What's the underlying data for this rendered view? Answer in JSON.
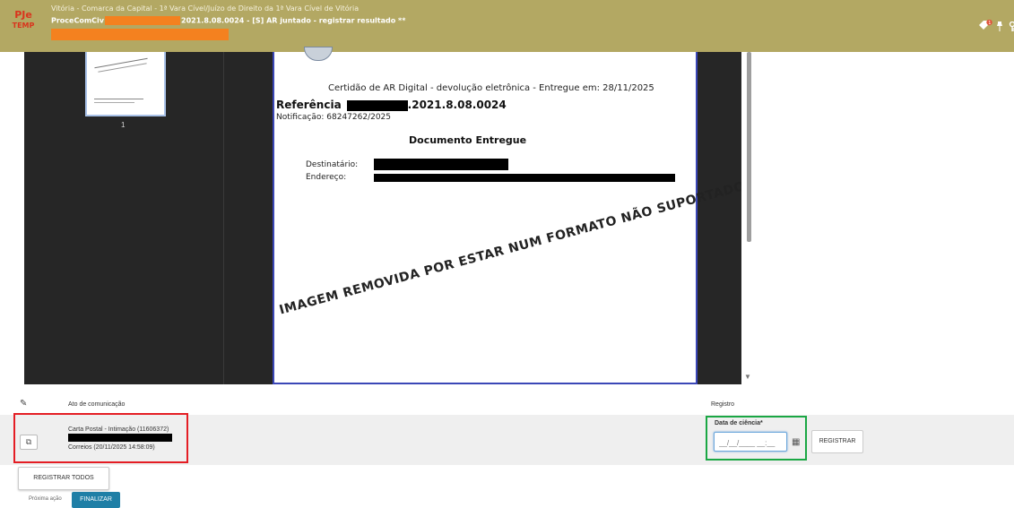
{
  "header": {
    "logo_line1": "PJe",
    "logo_line2": "TEMP",
    "court": "Vitória - Comarca da Capital - 1ª Vara Cível/Juízo de Direito da 1ª Vara Cível de Vitória",
    "class": "ProceComCiv",
    "process_suffix": "2021.8.08.0024 - [S] AR juntado - registrar resultado **",
    "notification_count": "1",
    "icons": [
      "tags-icon",
      "pin-icon",
      "key-icon"
    ]
  },
  "viewer": {
    "thumbnail_page": "1",
    "document": {
      "certidao": "Certidão de AR Digital - devolução eletrônica - Entregue em: 28/11/2025",
      "referencia_label": "Referência",
      "referencia_suffix": ".2021.8.08.0024",
      "notificacao": "Notificação:  68247262/2025",
      "entregue": "Documento Entregue",
      "destinatario_label": "Destinatário:",
      "endereco_label": "Endereço:",
      "removed_notice": "IMAGEM REMOVIDA POR ESTAR NUM FORMATO NÃO SUPORTADO"
    }
  },
  "table": {
    "col_ato": "Ato de comunicação",
    "col_registro": "Registro",
    "row": {
      "line1": "Carta Postal - Intimação (11606372)",
      "line3": "Correios (20/11/2025 14:58:09)"
    },
    "date_label": "Data de ciência*",
    "date_placeholder": "__/__/____ __:__",
    "registrar_label": "REGISTRAR"
  },
  "footer": {
    "registrar_todos": "REGISTRAR TODOS",
    "proxima_acao": "Próxima ação",
    "finalizar": "FINALIZAR"
  },
  "colors": {
    "topbar": "#b3a863",
    "highlight_orange": "#f4811f",
    "red_frame": "#e41d24",
    "green_frame": "#1aa744",
    "blue_frame": "#3b47b7",
    "finalizar_bg": "#1f7fa6"
  }
}
